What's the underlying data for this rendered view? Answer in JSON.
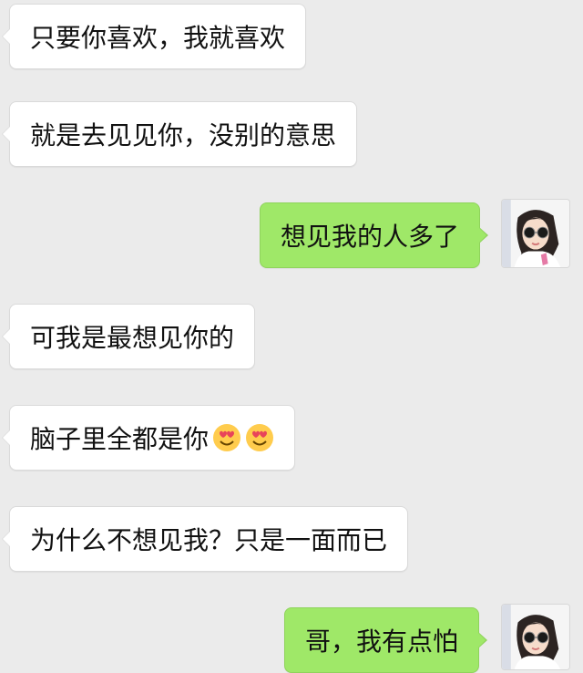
{
  "messages": [
    {
      "side": "left",
      "text": "只要你喜欢，我就喜欢"
    },
    {
      "side": "left",
      "text": "就是去见见你，没别的意思"
    },
    {
      "side": "right",
      "text": "想见我的人多了"
    },
    {
      "side": "left",
      "text": "可我是最想见你的"
    },
    {
      "side": "left",
      "text": "脑子里全都是你",
      "emoji": [
        "heart-eyes-emoji",
        "heart-eyes-emoji"
      ]
    },
    {
      "side": "left",
      "text": "为什么不想见我？只是一面而已"
    },
    {
      "side": "right",
      "text": "哥，我有点怕"
    }
  ],
  "colors": {
    "background": "#ebebeb",
    "incoming_bubble": "#ffffff",
    "outgoing_bubble": "#9fe868"
  }
}
